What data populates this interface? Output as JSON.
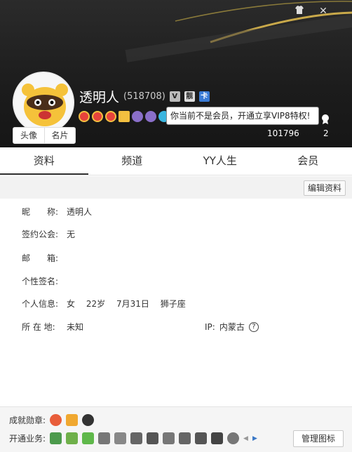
{
  "window": {
    "skin_icon": "shirt-icon",
    "close_icon": "close-icon"
  },
  "profile": {
    "nickname": "透明人",
    "uid": "(518708)",
    "avatar_tabs": [
      "头像",
      "名片"
    ],
    "tags": [
      "V",
      "靓",
      "卡"
    ],
    "vip_tooltip": "你当前不是会员，开通立享VIP8特权!",
    "stats": {
      "left": "101796",
      "right": "2"
    }
  },
  "tabs": [
    "资料",
    "频道",
    "YY人生",
    "会员"
  ],
  "content": {
    "edit_button": "编辑资料",
    "rows": [
      {
        "label": "昵　　称:",
        "value": "透明人"
      },
      {
        "label": "签约公会:",
        "value": "无"
      },
      {
        "label": "邮　　箱:",
        "value": ""
      },
      {
        "label": "个性签名:",
        "value": ""
      },
      {
        "label": "个人信息:",
        "value_parts": [
          "女",
          "22岁",
          "7月31日",
          "狮子座"
        ]
      },
      {
        "label": "所 在 地:",
        "value": "未知"
      }
    ],
    "ip_label": "IP:",
    "ip_value": "内蒙古",
    "help_icon": "?"
  },
  "footer": {
    "medals_label": "成就勋章:",
    "services_label": "开通业务:",
    "manage_button": "管理图标",
    "colors": {
      "accent": "#e8c14a",
      "header_bg": "#1c1c1c"
    }
  }
}
